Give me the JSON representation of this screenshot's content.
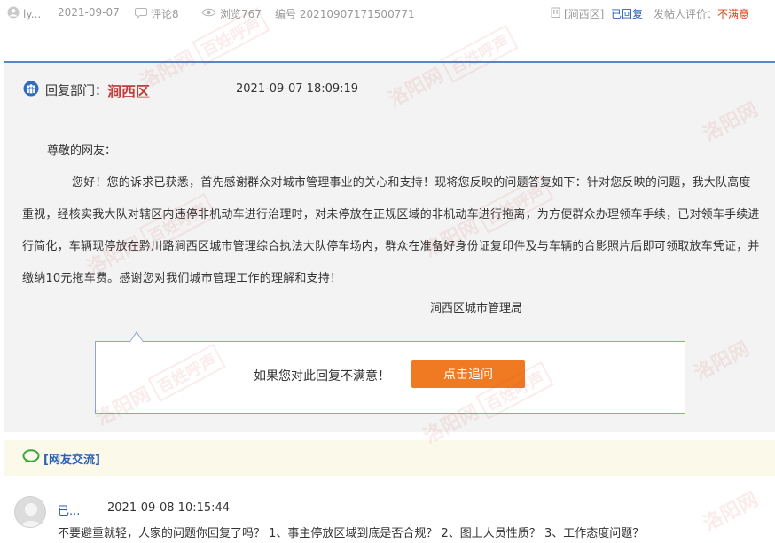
{
  "meta": {
    "author": "ly...",
    "date": "2021-09-07",
    "comments": "评论8",
    "views": "浏览767",
    "number": "编号 20210907171500771",
    "dept_tag": "[涧西区]",
    "status": "已回复",
    "rating_label": "发帖人评价：",
    "rating_value": "不满意"
  },
  "reply": {
    "label": "回复部门：",
    "dept": "涧西区",
    "time": "2021-09-07 18:09:19",
    "greeting": "尊敬的网友：",
    "body": "您好！您的诉求已获悉，首先感谢群众对城市管理事业的关心和支持！现将您反映的问题答复如下：针对您反映的问题，我大队高度重视，经核实我大队对辖区内违停非机动车进行治理时，对未停放在正规区域的非机动车进行拖离，为方便群众办理领车手续，已对领车手续进行简化，车辆现停放在黔川路涧西区城市管理综合执法大队停车场内，群众在准备好身份证复印件及与车辆的合影照片后即可领取放车凭证，并缴纳10元拖车费。感谢您对我们城市管理工作的理解和支持！",
    "signature": "涧西区城市管理局"
  },
  "feedback": {
    "question": "如果您对此回复不满意！",
    "button": "点击追问"
  },
  "comments": {
    "title": "[网友交流]",
    "items": [
      {
        "user": "已...",
        "time": "2021-09-08 10:15:44",
        "text": "不要避重就轻，人家的问题你回复了吗？ 1、事主停放区域到底是否合规？ 2、图上人员性质？ 3、工作态度问题？"
      }
    ]
  },
  "watermark": {
    "text": "洛阳网",
    "box": "百姓呼声"
  },
  "colors": {
    "accent_blue": "#2a62b3",
    "border_blue": "#5b86c6",
    "warning_red": "#d7400f",
    "button_orange": "#f07a22"
  }
}
